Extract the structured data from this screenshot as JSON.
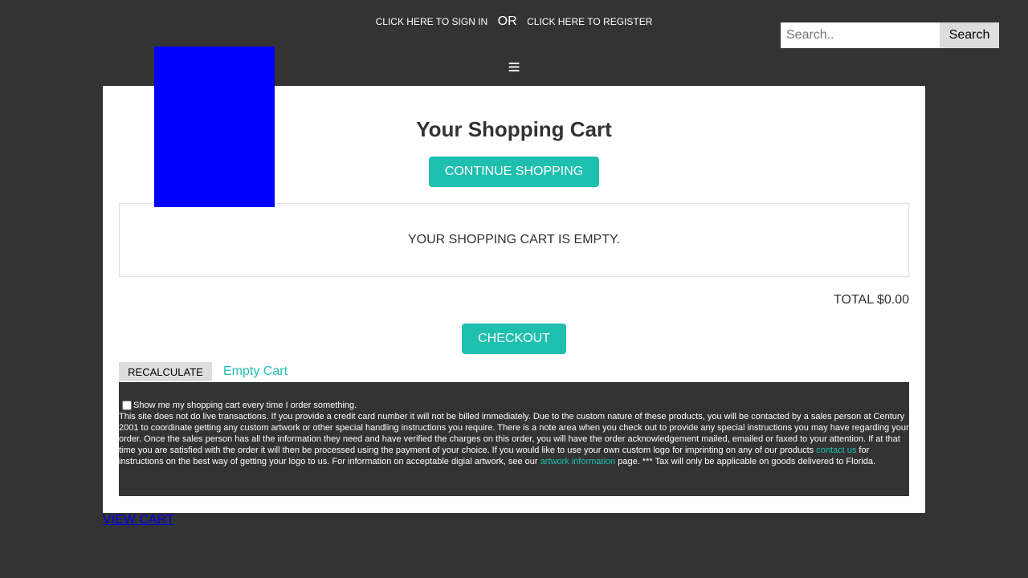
{
  "header": {
    "sign_in_label": "CLICK HERE TO SIGN IN",
    "or_label": "OR",
    "register_label": "CLICK HERE TO REGISTER",
    "menu_glyph": "≡",
    "menu_icon": "hamburger-menu-icon"
  },
  "search": {
    "placeholder": "Search..",
    "value": "",
    "button_label": "Search"
  },
  "logo": {
    "color": "#0000ff"
  },
  "cart": {
    "title": "Your Shopping Cart",
    "continue_label": "CONTINUE SHOPPING",
    "empty_message": "YOUR SHOPPING CART IS EMPTY.",
    "total_label": "TOTAL $0.00",
    "checkout_label": "CHECKOUT",
    "recalculate_label": "RECALCULATE",
    "empty_cart_label": "Empty Cart"
  },
  "notice": {
    "checkbox_label": "Show me my shopping cart every time I order something.",
    "text_part1": "This site does not do live transactions. If you provide a credit card number it will not be billed immediately. Due to the custom nature of these products, you will be contacted by a sales person at Century 2001 to coordinate getting any custom artwork or other special handling instructions you require. There is a note area when you check out to provide any special instructions you may have regarding your order. Once the sales person has all the information they need and have verified the charges on this order, you will have the order acknowledgement mailed, emailed or faxed to your attention. If at that time you are satisfied with the order it will then be processed using the payment of your choice. If you would like to use your own custom logo for imprinting on any of our products ",
    "contact_link": "contact us",
    "text_part2": " for instructions on the best way of getting your logo to us. For information on acceptable digial artwork, see our ",
    "artwork_link": "artwork information",
    "text_part3": " page. *** Tax will only be applicable on goods delivered to Florida."
  },
  "footer": {
    "view_cart_label": "VIEW CART"
  },
  "colors": {
    "background": "#333333",
    "accent": "#1fbfb0",
    "panel": "#ffffff",
    "logo": "#0000ff"
  }
}
